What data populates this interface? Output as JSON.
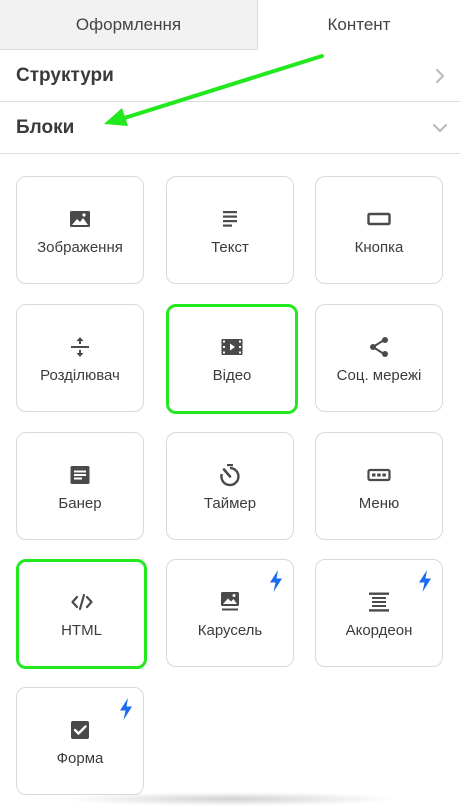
{
  "tabs": {
    "design": "Оформлення",
    "content": "Контент"
  },
  "sections": {
    "structures": "Структури",
    "blocks": "Блоки"
  },
  "blocks": [
    {
      "label": "Зображення",
      "icon": "image-icon",
      "pro": false,
      "highlighted": false
    },
    {
      "label": "Текст",
      "icon": "text-icon",
      "pro": false,
      "highlighted": false
    },
    {
      "label": "Кнопка",
      "icon": "button-icon",
      "pro": false,
      "highlighted": false
    },
    {
      "label": "Розділювач",
      "icon": "divider-icon",
      "pro": false,
      "highlighted": false
    },
    {
      "label": "Відео",
      "icon": "video-icon",
      "pro": false,
      "highlighted": true
    },
    {
      "label": "Соц. мережі",
      "icon": "share-icon",
      "pro": false,
      "highlighted": false
    },
    {
      "label": "Банер",
      "icon": "banner-icon",
      "pro": false,
      "highlighted": false
    },
    {
      "label": "Таймер",
      "icon": "timer-icon",
      "pro": false,
      "highlighted": false
    },
    {
      "label": "Меню",
      "icon": "menu-icon",
      "pro": false,
      "highlighted": false
    },
    {
      "label": "HTML",
      "icon": "code-icon",
      "pro": false,
      "highlighted": true
    },
    {
      "label": "Карусель",
      "icon": "carousel-icon",
      "pro": true,
      "highlighted": false
    },
    {
      "label": "Акордеон",
      "icon": "accordion-icon",
      "pro": true,
      "highlighted": false
    },
    {
      "label": "Форма",
      "icon": "form-icon",
      "pro": true,
      "highlighted": false
    }
  ],
  "colors": {
    "highlight": "#22e81e",
    "bolt": "#1a6cf0",
    "icon": "#4a4a4a",
    "border": "#d9d9d9"
  }
}
